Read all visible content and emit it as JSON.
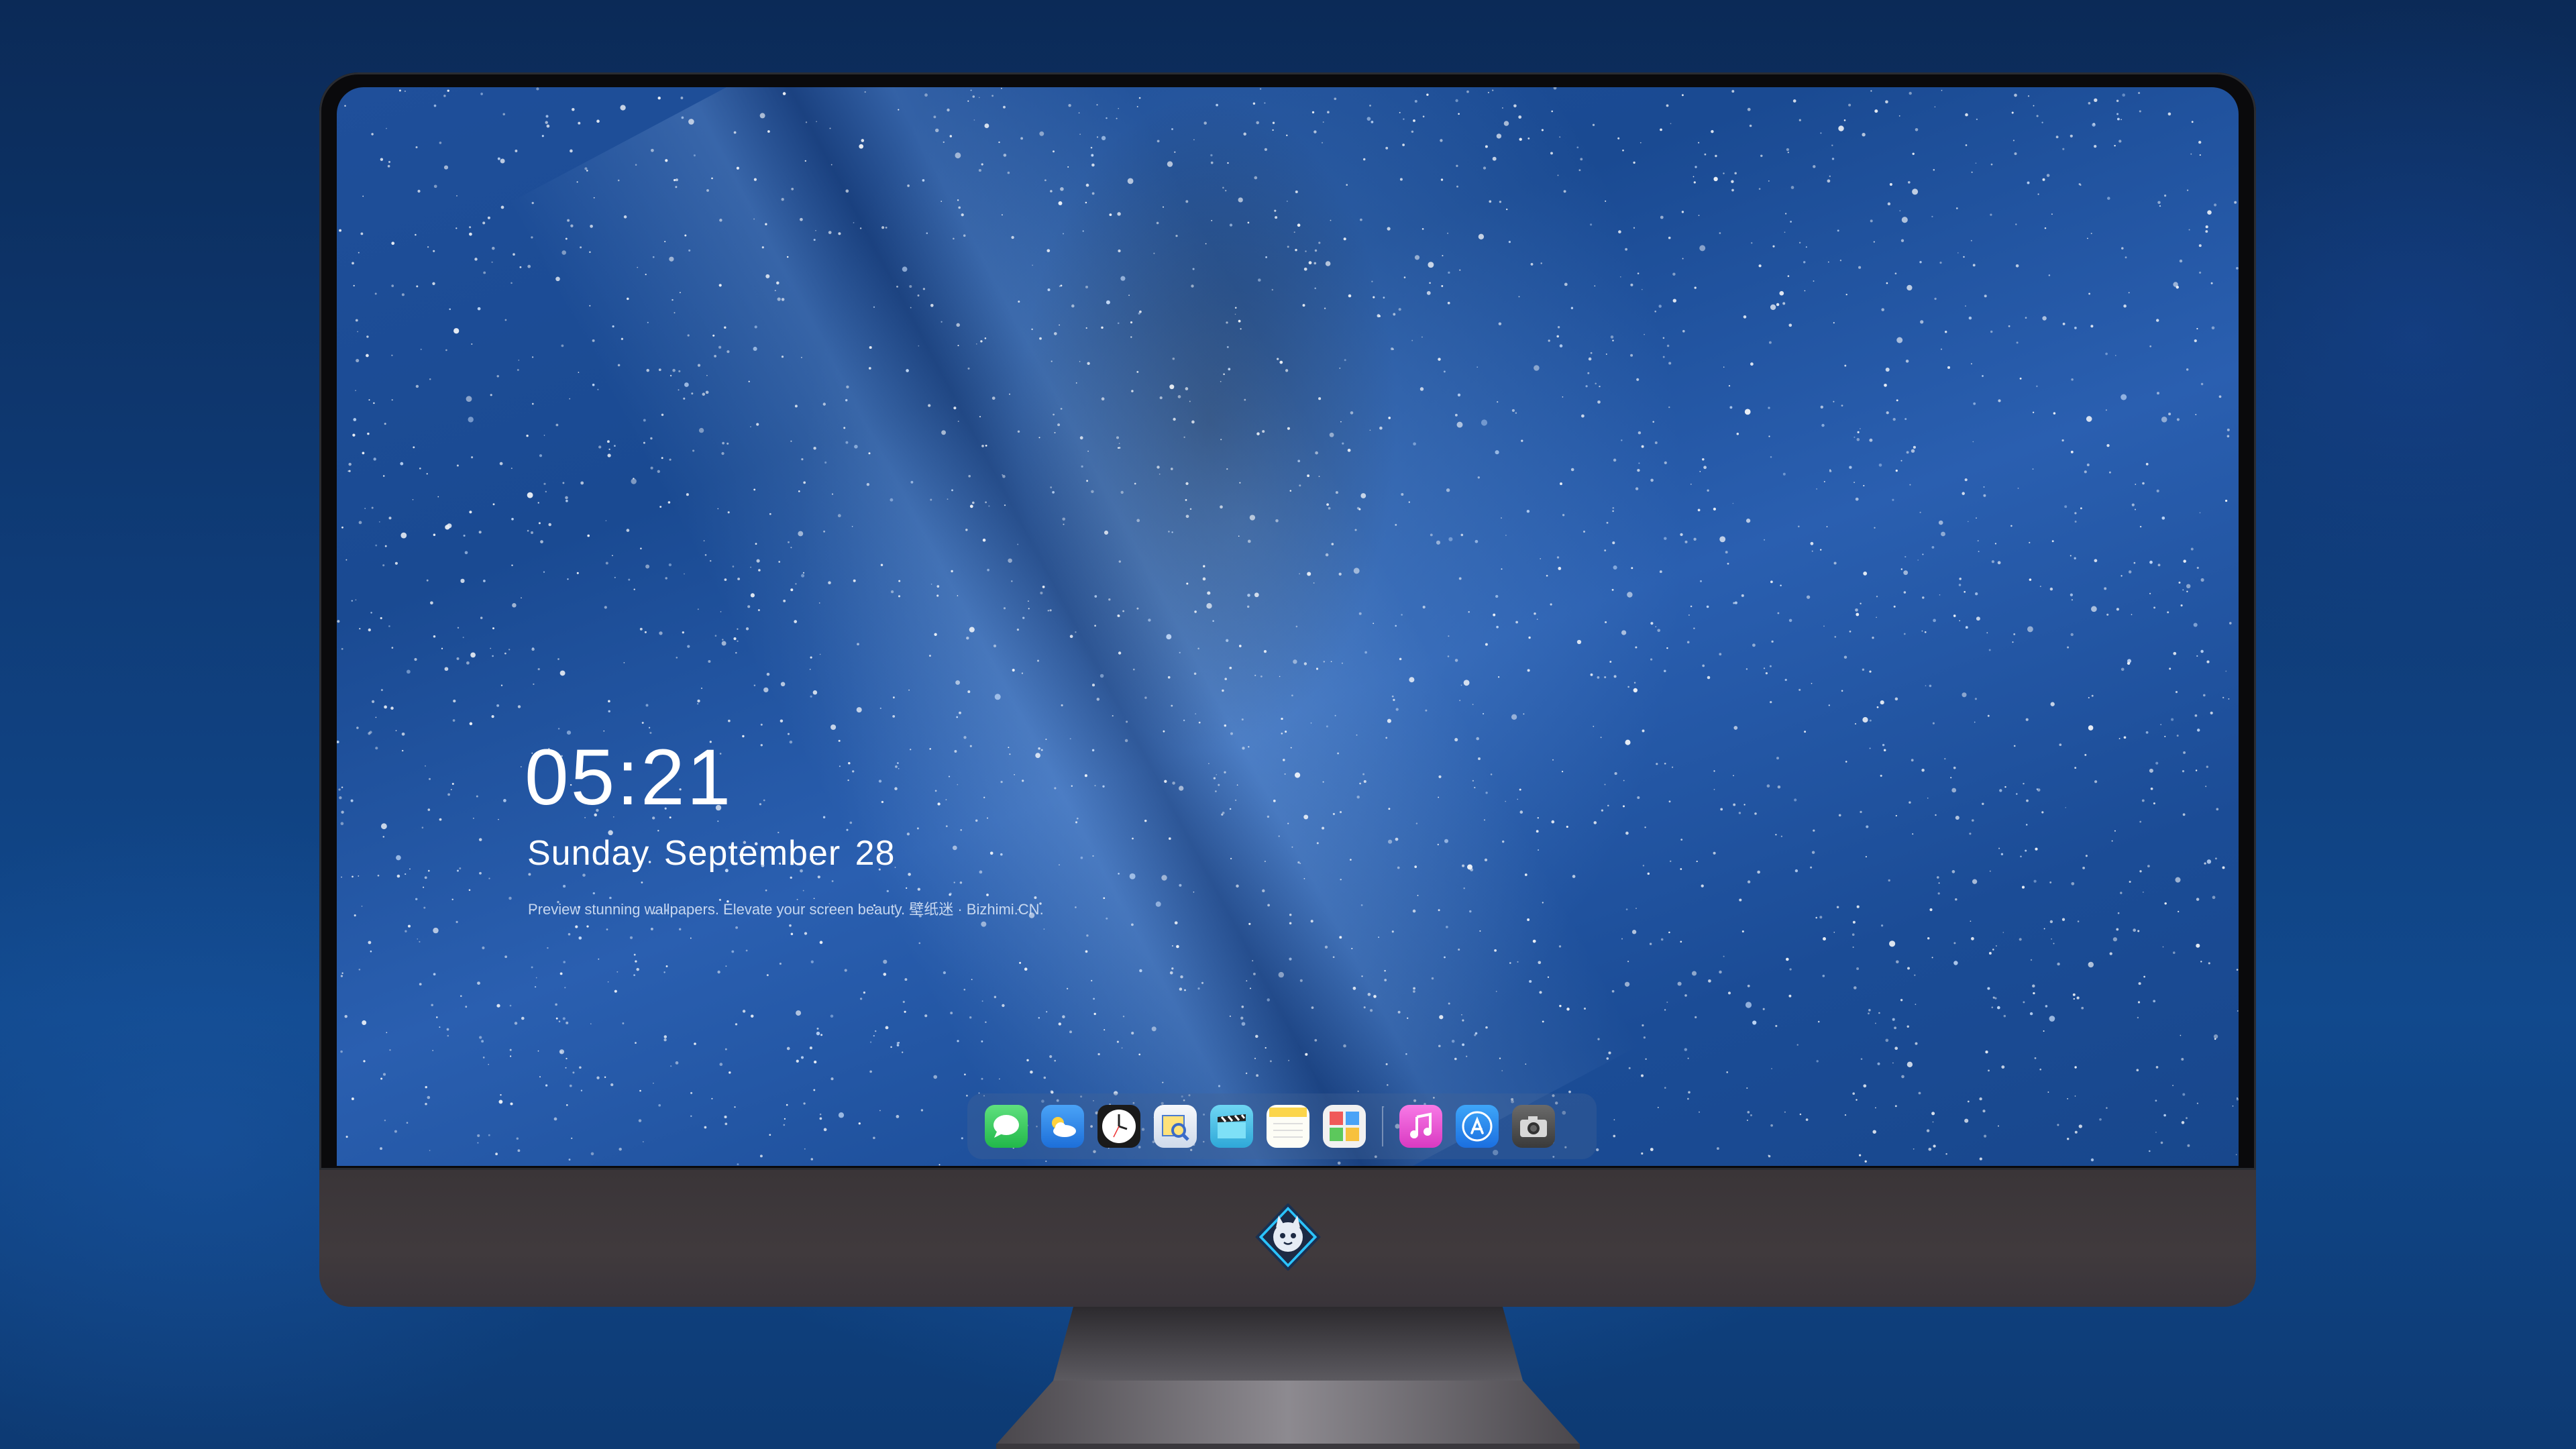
{
  "lockscreen": {
    "time": "05:21",
    "date": "Sunday September  28",
    "tagline": "Preview stunning wallpapers. Elevate your screen beauty. 壁纸迷 · Bizhimi.CN."
  },
  "dock": {
    "apps": [
      {
        "name": "messages-icon",
        "color": "#31c75a"
      },
      {
        "name": "weather-icon",
        "color": "#3a8ff0"
      },
      {
        "name": "clock-icon",
        "color": "#111111"
      },
      {
        "name": "preview-icon",
        "color": "#e8eef8"
      },
      {
        "name": "clapper-icon",
        "color": "#4fc3e8"
      },
      {
        "name": "notes-icon",
        "color": "#fbd54a"
      },
      {
        "name": "photo-booth-icon",
        "color": "#f2f2f2"
      },
      {
        "name": "music-icon",
        "color": "#ee4fd7"
      },
      {
        "name": "app-store-icon",
        "color": "#2a8ef5"
      },
      {
        "name": "camera-icon",
        "color": "#555555"
      }
    ]
  },
  "colors": {
    "background": "#0f3c78",
    "chin": "#3d383b",
    "bezel": "#0a0a0c"
  }
}
